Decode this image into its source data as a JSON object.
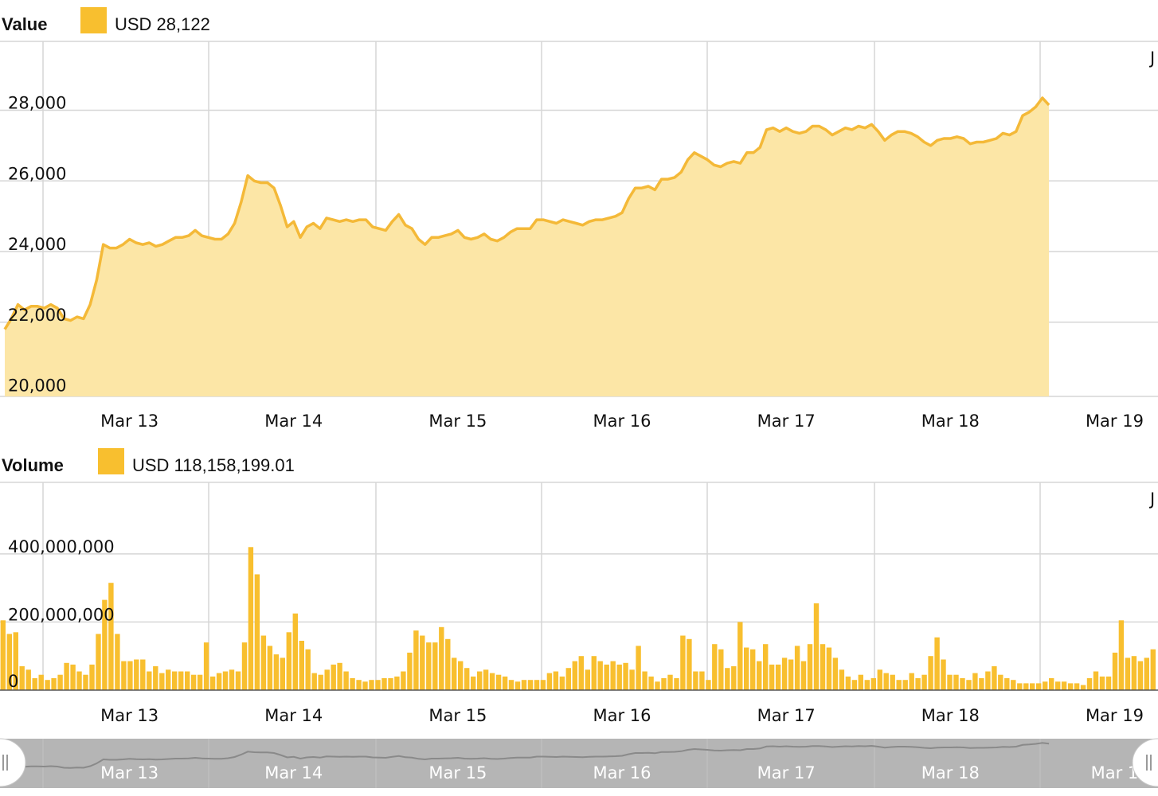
{
  "colors": {
    "accent": "#F8BF2F",
    "line": "#F4B938",
    "area_fill": "#FCE6A6",
    "grid": "#D6D6D6",
    "navigator_bg": "#B5B5B5",
    "navigator_line": "#8A8A8A"
  },
  "icons": {
    "navigator_left": "grip-handle-icon",
    "navigator_right": "grip-handle-icon"
  },
  "chart_data": [
    {
      "type": "area",
      "legend": {
        "title": "Value",
        "value": "USD 28,122"
      },
      "ylim": [
        20000,
        30000
      ],
      "y_ticks": [
        "20,000",
        "22,000",
        "24,000",
        "26,000",
        "28,000"
      ],
      "y_tick_values": [
        20000,
        22000,
        24000,
        26000,
        28000
      ],
      "corner_label": "J",
      "x_ticks": [
        "Mar 13",
        "Mar 14",
        "Mar 15",
        "Mar 16",
        "Mar 17",
        "Mar 18",
        "Mar 19"
      ],
      "x_tick_values": [
        12.75,
        13.75,
        14.75,
        15.75,
        16.75,
        17.75,
        18.75
      ],
      "xlim": [
        12.0,
        19.0
      ],
      "grid": true,
      "points": [
        [
          12.0,
          21800
        ],
        [
          12.04,
          22100
        ],
        [
          12.08,
          22500
        ],
        [
          12.12,
          22350
        ],
        [
          12.16,
          22450
        ],
        [
          12.2,
          22450
        ],
        [
          12.24,
          22400
        ],
        [
          12.28,
          22500
        ],
        [
          12.32,
          22400
        ],
        [
          12.36,
          22100
        ],
        [
          12.4,
          22050
        ],
        [
          12.44,
          22150
        ],
        [
          12.48,
          22100
        ],
        [
          12.52,
          22500
        ],
        [
          12.56,
          23200
        ],
        [
          12.6,
          24200
        ],
        [
          12.64,
          24100
        ],
        [
          12.68,
          24100
        ],
        [
          12.72,
          24200
        ],
        [
          12.76,
          24350
        ],
        [
          12.8,
          24250
        ],
        [
          12.84,
          24200
        ],
        [
          12.88,
          24250
        ],
        [
          12.92,
          24150
        ],
        [
          12.96,
          24200
        ],
        [
          13.0,
          24300
        ],
        [
          13.04,
          24400
        ],
        [
          13.08,
          24400
        ],
        [
          13.12,
          24450
        ],
        [
          13.16,
          24600
        ],
        [
          13.2,
          24450
        ],
        [
          13.24,
          24400
        ],
        [
          13.28,
          24350
        ],
        [
          13.32,
          24350
        ],
        [
          13.36,
          24500
        ],
        [
          13.4,
          24800
        ],
        [
          13.44,
          25400
        ],
        [
          13.48,
          26150
        ],
        [
          13.52,
          26000
        ],
        [
          13.56,
          25950
        ],
        [
          13.6,
          25950
        ],
        [
          13.64,
          25800
        ],
        [
          13.68,
          25300
        ],
        [
          13.72,
          24700
        ],
        [
          13.76,
          24850
        ],
        [
          13.8,
          24400
        ],
        [
          13.84,
          24700
        ],
        [
          13.88,
          24800
        ],
        [
          13.92,
          24650
        ],
        [
          13.96,
          24950
        ],
        [
          14.0,
          24900
        ],
        [
          14.04,
          24850
        ],
        [
          14.08,
          24900
        ],
        [
          14.12,
          24850
        ],
        [
          14.16,
          24900
        ],
        [
          14.2,
          24900
        ],
        [
          14.24,
          24700
        ],
        [
          14.28,
          24650
        ],
        [
          14.32,
          24600
        ],
        [
          14.36,
          24850
        ],
        [
          14.4,
          25050
        ],
        [
          14.44,
          24750
        ],
        [
          14.48,
          24650
        ],
        [
          14.52,
          24350
        ],
        [
          14.56,
          24200
        ],
        [
          14.6,
          24400
        ],
        [
          14.64,
          24400
        ],
        [
          14.68,
          24450
        ],
        [
          14.72,
          24500
        ],
        [
          14.76,
          24600
        ],
        [
          14.8,
          24400
        ],
        [
          14.84,
          24350
        ],
        [
          14.88,
          24400
        ],
        [
          14.92,
          24500
        ],
        [
          14.96,
          24350
        ],
        [
          15.0,
          24300
        ],
        [
          15.04,
          24400
        ],
        [
          15.08,
          24550
        ],
        [
          15.12,
          24650
        ],
        [
          15.16,
          24650
        ],
        [
          15.2,
          24650
        ],
        [
          15.24,
          24900
        ],
        [
          15.28,
          24900
        ],
        [
          15.32,
          24850
        ],
        [
          15.36,
          24800
        ],
        [
          15.4,
          24900
        ],
        [
          15.44,
          24850
        ],
        [
          15.48,
          24800
        ],
        [
          15.52,
          24750
        ],
        [
          15.56,
          24850
        ],
        [
          15.6,
          24900
        ],
        [
          15.64,
          24900
        ],
        [
          15.68,
          24950
        ],
        [
          15.72,
          25000
        ],
        [
          15.76,
          25100
        ],
        [
          15.8,
          25500
        ],
        [
          15.84,
          25800
        ],
        [
          15.88,
          25800
        ],
        [
          15.92,
          25850
        ],
        [
          15.96,
          25750
        ],
        [
          16.0,
          26050
        ],
        [
          16.04,
          26050
        ],
        [
          16.08,
          26100
        ],
        [
          16.12,
          26250
        ],
        [
          16.16,
          26600
        ],
        [
          16.2,
          26800
        ],
        [
          16.24,
          26700
        ],
        [
          16.28,
          26600
        ],
        [
          16.32,
          26450
        ],
        [
          16.36,
          26400
        ],
        [
          16.4,
          26500
        ],
        [
          16.44,
          26550
        ],
        [
          16.48,
          26500
        ],
        [
          16.52,
          26800
        ],
        [
          16.56,
          26800
        ],
        [
          16.6,
          26950
        ],
        [
          16.64,
          27450
        ],
        [
          16.68,
          27500
        ],
        [
          16.72,
          27400
        ],
        [
          16.76,
          27500
        ],
        [
          16.8,
          27400
        ],
        [
          16.84,
          27350
        ],
        [
          16.88,
          27400
        ],
        [
          16.92,
          27550
        ],
        [
          16.96,
          27550
        ],
        [
          17.0,
          27450
        ],
        [
          17.04,
          27300
        ],
        [
          17.08,
          27400
        ],
        [
          17.12,
          27500
        ],
        [
          17.16,
          27450
        ],
        [
          17.2,
          27550
        ],
        [
          17.24,
          27500
        ],
        [
          17.28,
          27600
        ],
        [
          17.32,
          27400
        ],
        [
          17.36,
          27150
        ],
        [
          17.4,
          27300
        ],
        [
          17.44,
          27400
        ],
        [
          17.48,
          27400
        ],
        [
          17.52,
          27350
        ],
        [
          17.56,
          27250
        ],
        [
          17.6,
          27100
        ],
        [
          17.64,
          27000
        ],
        [
          17.68,
          27150
        ],
        [
          17.72,
          27200
        ],
        [
          17.76,
          27200
        ],
        [
          17.8,
          27250
        ],
        [
          17.84,
          27200
        ],
        [
          17.88,
          27050
        ],
        [
          17.92,
          27100
        ],
        [
          17.96,
          27100
        ],
        [
          18.0,
          27150
        ],
        [
          18.04,
          27200
        ],
        [
          18.08,
          27350
        ],
        [
          18.12,
          27300
        ],
        [
          18.16,
          27400
        ],
        [
          18.2,
          27850
        ],
        [
          18.24,
          27950
        ],
        [
          18.28,
          28100
        ],
        [
          18.32,
          28350
        ],
        [
          18.36,
          28150
        ]
      ]
    },
    {
      "type": "bar",
      "legend": {
        "title": "Volume",
        "value": "USD 118,158,199.01"
      },
      "ylim": [
        0,
        600000000
      ],
      "y_ticks": [
        "0",
        "200,000,000",
        "400,000,000"
      ],
      "y_tick_values": [
        0,
        200000000,
        400000000
      ],
      "corner_label": "J",
      "x_ticks": [
        "Mar 13",
        "Mar 14",
        "Mar 15",
        "Mar 16",
        "Mar 17",
        "Mar 18",
        "Mar 19"
      ],
      "x_tick_values": [
        12.75,
        13.75,
        14.75,
        15.75,
        16.75,
        17.75,
        18.75
      ],
      "xlim": [
        12.0,
        19.0
      ],
      "grid": true,
      "bar_spacing": 0.0333,
      "values": [
        205000000,
        165000000,
        170000000,
        70000000,
        60000000,
        35000000,
        45000000,
        30000000,
        35000000,
        45000000,
        80000000,
        75000000,
        55000000,
        45000000,
        75000000,
        165000000,
        265000000,
        315000000,
        165000000,
        85000000,
        85000000,
        90000000,
        90000000,
        55000000,
        70000000,
        50000000,
        60000000,
        55000000,
        55000000,
        55000000,
        45000000,
        45000000,
        140000000,
        40000000,
        50000000,
        55000000,
        60000000,
        55000000,
        140000000,
        420000000,
        340000000,
        160000000,
        130000000,
        105000000,
        95000000,
        170000000,
        225000000,
        145000000,
        120000000,
        50000000,
        45000000,
        60000000,
        75000000,
        80000000,
        55000000,
        35000000,
        30000000,
        25000000,
        30000000,
        30000000,
        35000000,
        35000000,
        40000000,
        55000000,
        110000000,
        175000000,
        160000000,
        140000000,
        140000000,
        185000000,
        150000000,
        95000000,
        85000000,
        65000000,
        40000000,
        55000000,
        60000000,
        50000000,
        45000000,
        40000000,
        30000000,
        25000000,
        30000000,
        30000000,
        30000000,
        30000000,
        50000000,
        55000000,
        40000000,
        65000000,
        85000000,
        100000000,
        60000000,
        100000000,
        85000000,
        75000000,
        85000000,
        75000000,
        80000000,
        60000000,
        130000000,
        55000000,
        40000000,
        25000000,
        35000000,
        45000000,
        35000000,
        160000000,
        150000000,
        55000000,
        55000000,
        30000000,
        135000000,
        120000000,
        65000000,
        70000000,
        200000000,
        125000000,
        120000000,
        85000000,
        135000000,
        75000000,
        75000000,
        95000000,
        90000000,
        130000000,
        85000000,
        135000000,
        255000000,
        135000000,
        125000000,
        95000000,
        60000000,
        40000000,
        30000000,
        45000000,
        30000000,
        35000000,
        60000000,
        50000000,
        45000000,
        30000000,
        30000000,
        50000000,
        35000000,
        45000000,
        100000000,
        155000000,
        90000000,
        45000000,
        45000000,
        35000000,
        30000000,
        50000000,
        35000000,
        55000000,
        70000000,
        45000000,
        35000000,
        30000000,
        20000000,
        20000000,
        20000000,
        20000000,
        25000000,
        35000000,
        25000000,
        25000000,
        20000000,
        20000000,
        15000000,
        35000000,
        55000000,
        40000000,
        40000000,
        110000000,
        205000000,
        95000000,
        100000000,
        85000000,
        95000000,
        120000000
      ]
    }
  ],
  "navigator": {
    "labels": [
      "Mar 13",
      "Mar 14",
      "Mar 15",
      "Mar 16",
      "Mar 17",
      "Mar 18",
      "Mar 1"
    ]
  }
}
